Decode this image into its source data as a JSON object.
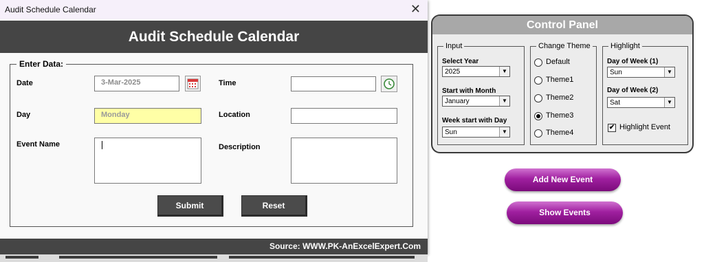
{
  "window": {
    "title": "Audit Schedule Calendar",
    "close_glyph": "✕",
    "banner_title": "Audit Schedule Calendar",
    "footer_text": "Source: WWW.PK-AnExcelExpert.Com"
  },
  "form": {
    "group_label": "Enter Data:",
    "date_label": "Date",
    "date_value": "3-Mar-2025",
    "time_label": "Time",
    "time_value": "",
    "day_label": "Day",
    "day_value": "Monday",
    "location_label": "Location",
    "location_value": "",
    "event_name_label": "Event Name",
    "event_name_value": "",
    "description_label": "Description",
    "description_value": "",
    "submit_label": "Submit",
    "reset_label": "Reset",
    "calendar_icon": "calendar-icon",
    "clock_icon": "clock-icon"
  },
  "control_panel": {
    "title": "Control Panel",
    "input": {
      "legend": "Input",
      "select_year_label": "Select Year",
      "select_year_value": "2025",
      "start_month_label": "Start with Month",
      "start_month_value": "January",
      "week_start_label": "Week start with Day",
      "week_start_value": "Sun"
    },
    "theme": {
      "legend": "Change Theme",
      "options": [
        "Default",
        "Theme1",
        "Theme2",
        "Theme3",
        "Theme4"
      ],
      "selected": "Theme3"
    },
    "highlight": {
      "legend": "Highlight",
      "dow1_label": "Day of Week (1)",
      "dow1_value": "Sun",
      "dow2_label": "Day of Week (2)",
      "dow2_value": "Sat",
      "highlight_event_label": "Highlight Event",
      "highlight_event_checked": true,
      "check_glyph": "✔"
    }
  },
  "actions": {
    "add_new_event": "Add New Event",
    "show_events": "Show Events"
  },
  "colors": {
    "banner": "#454545",
    "day_field": "#ffffa6",
    "pill_purple": "#a020a0",
    "panel_header": "#a8a8a8"
  }
}
